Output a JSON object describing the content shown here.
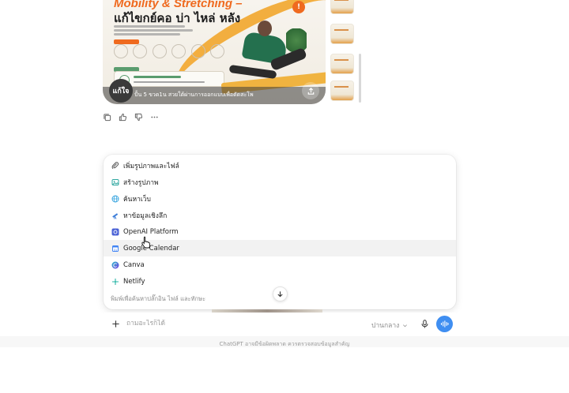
{
  "image_card": {
    "title": "Mobility & Stretching –",
    "subtitle": "แก้ไขกย์คอ บ่า ไหล่ หลัง",
    "caption": "ปั้น 5 ขวด1น สวยใต้ผ่านการออกแบบเพื่อดัดสะโพ",
    "brand": "แก้ใจ",
    "badge": "!"
  },
  "message_actions": [
    "copy-icon",
    "thumbs-up-icon",
    "thumbs-down-icon",
    "more-icon"
  ],
  "tools_menu": {
    "items": [
      {
        "label": "เพิ่มรูปภาพและไฟล์",
        "icon": "paperclip-icon",
        "color": "#555555"
      },
      {
        "label": "สร้างรูปภาพ",
        "icon": "image-icon",
        "color": "#2fa7a0"
      },
      {
        "label": "ค้นหาเว็บ",
        "icon": "globe-icon",
        "color": "#3ca7e0"
      },
      {
        "label": "หาข้อมูลเชิงลึก",
        "icon": "telescope-icon",
        "color": "#3f7fd9"
      },
      {
        "label": "OpenAI Platform",
        "icon": "openai-platform-icon",
        "color": "#4c63d6"
      },
      {
        "label": "Google Calendar",
        "icon": "calendar-icon",
        "color": "#4285f4"
      },
      {
        "label": "Canva",
        "icon": "canva-icon",
        "color": "#1fb7c9"
      },
      {
        "label": "Netlify",
        "icon": "netlify-icon",
        "color": "#28b5a6"
      }
    ],
    "hovered_index": 5,
    "hint": "พิมพ์เพื่อค้นหาปลั๊กอิน ไฟล์ และทักษะ"
  },
  "composer": {
    "placeholder": "ถามอะไรก็ได้",
    "model_label": "ปานกลาง",
    "accent": "#3f8ef1"
  },
  "disclaimer": "ChatGPT อาจมีข้อผิดพลาด ควรตรวจสอบข้อมูลสำคัญ"
}
